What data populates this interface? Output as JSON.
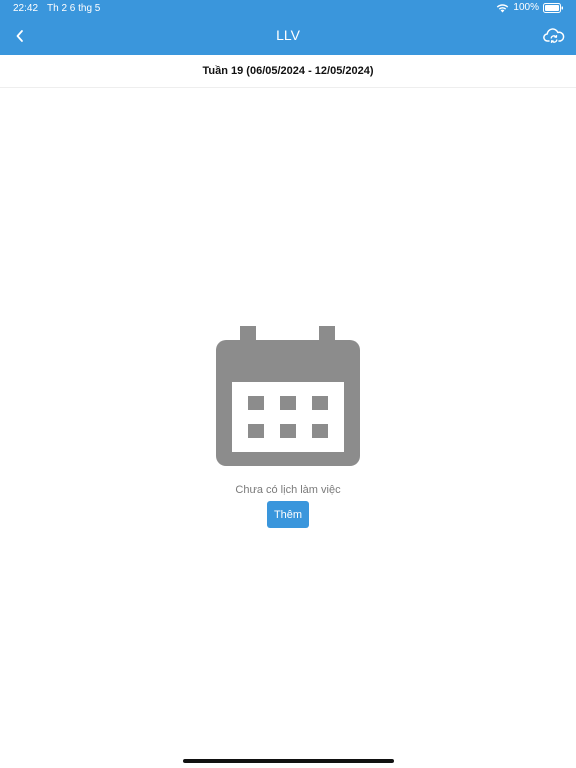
{
  "status_bar": {
    "time": "22:42",
    "date": "Th 2 6 thg 5",
    "battery": "100%"
  },
  "header": {
    "title": "LLV",
    "back_icon": "chevron-left-icon",
    "sync_icon": "cloud-sync-icon"
  },
  "week": {
    "label": "Tuần 19 (06/05/2024 - 12/05/2024)"
  },
  "empty_state": {
    "icon": "calendar-icon",
    "message": "Chưa có lịch làm việc",
    "add_label": "Thêm"
  },
  "colors": {
    "header": "#3a96dc",
    "icon_gray": "#8c8c8c",
    "button": "#3a96dc"
  }
}
